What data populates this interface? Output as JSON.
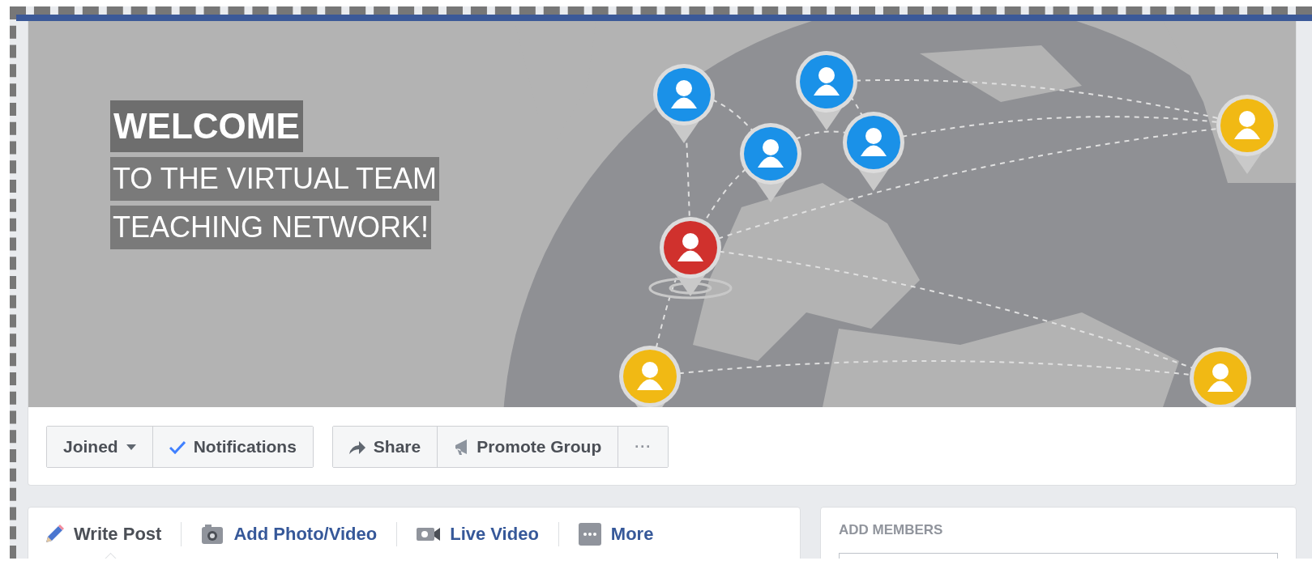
{
  "cover": {
    "headline": "WELCOME",
    "lines": [
      "TO THE VIRTUAL TEAM",
      "TEACHING NETWORK!"
    ]
  },
  "action_groups": [
    {
      "buttons": [
        {
          "kind": "dropdown",
          "label": "Joined"
        },
        {
          "kind": "toggle",
          "label": "Notifications",
          "checked": true
        }
      ]
    },
    {
      "buttons": [
        {
          "kind": "share",
          "label": "Share"
        },
        {
          "kind": "promote",
          "label": "Promote Group"
        },
        {
          "kind": "more",
          "label": "···"
        }
      ]
    }
  ],
  "composer": {
    "tabs": [
      {
        "kind": "write",
        "label": "Write Post",
        "selected": true
      },
      {
        "kind": "photo",
        "label": "Add Photo/Video",
        "selected": false
      },
      {
        "kind": "live",
        "label": "Live Video",
        "selected": false
      },
      {
        "kind": "more",
        "label": "More",
        "selected": false
      }
    ]
  },
  "add_members": {
    "title": "ADD MEMBERS"
  }
}
